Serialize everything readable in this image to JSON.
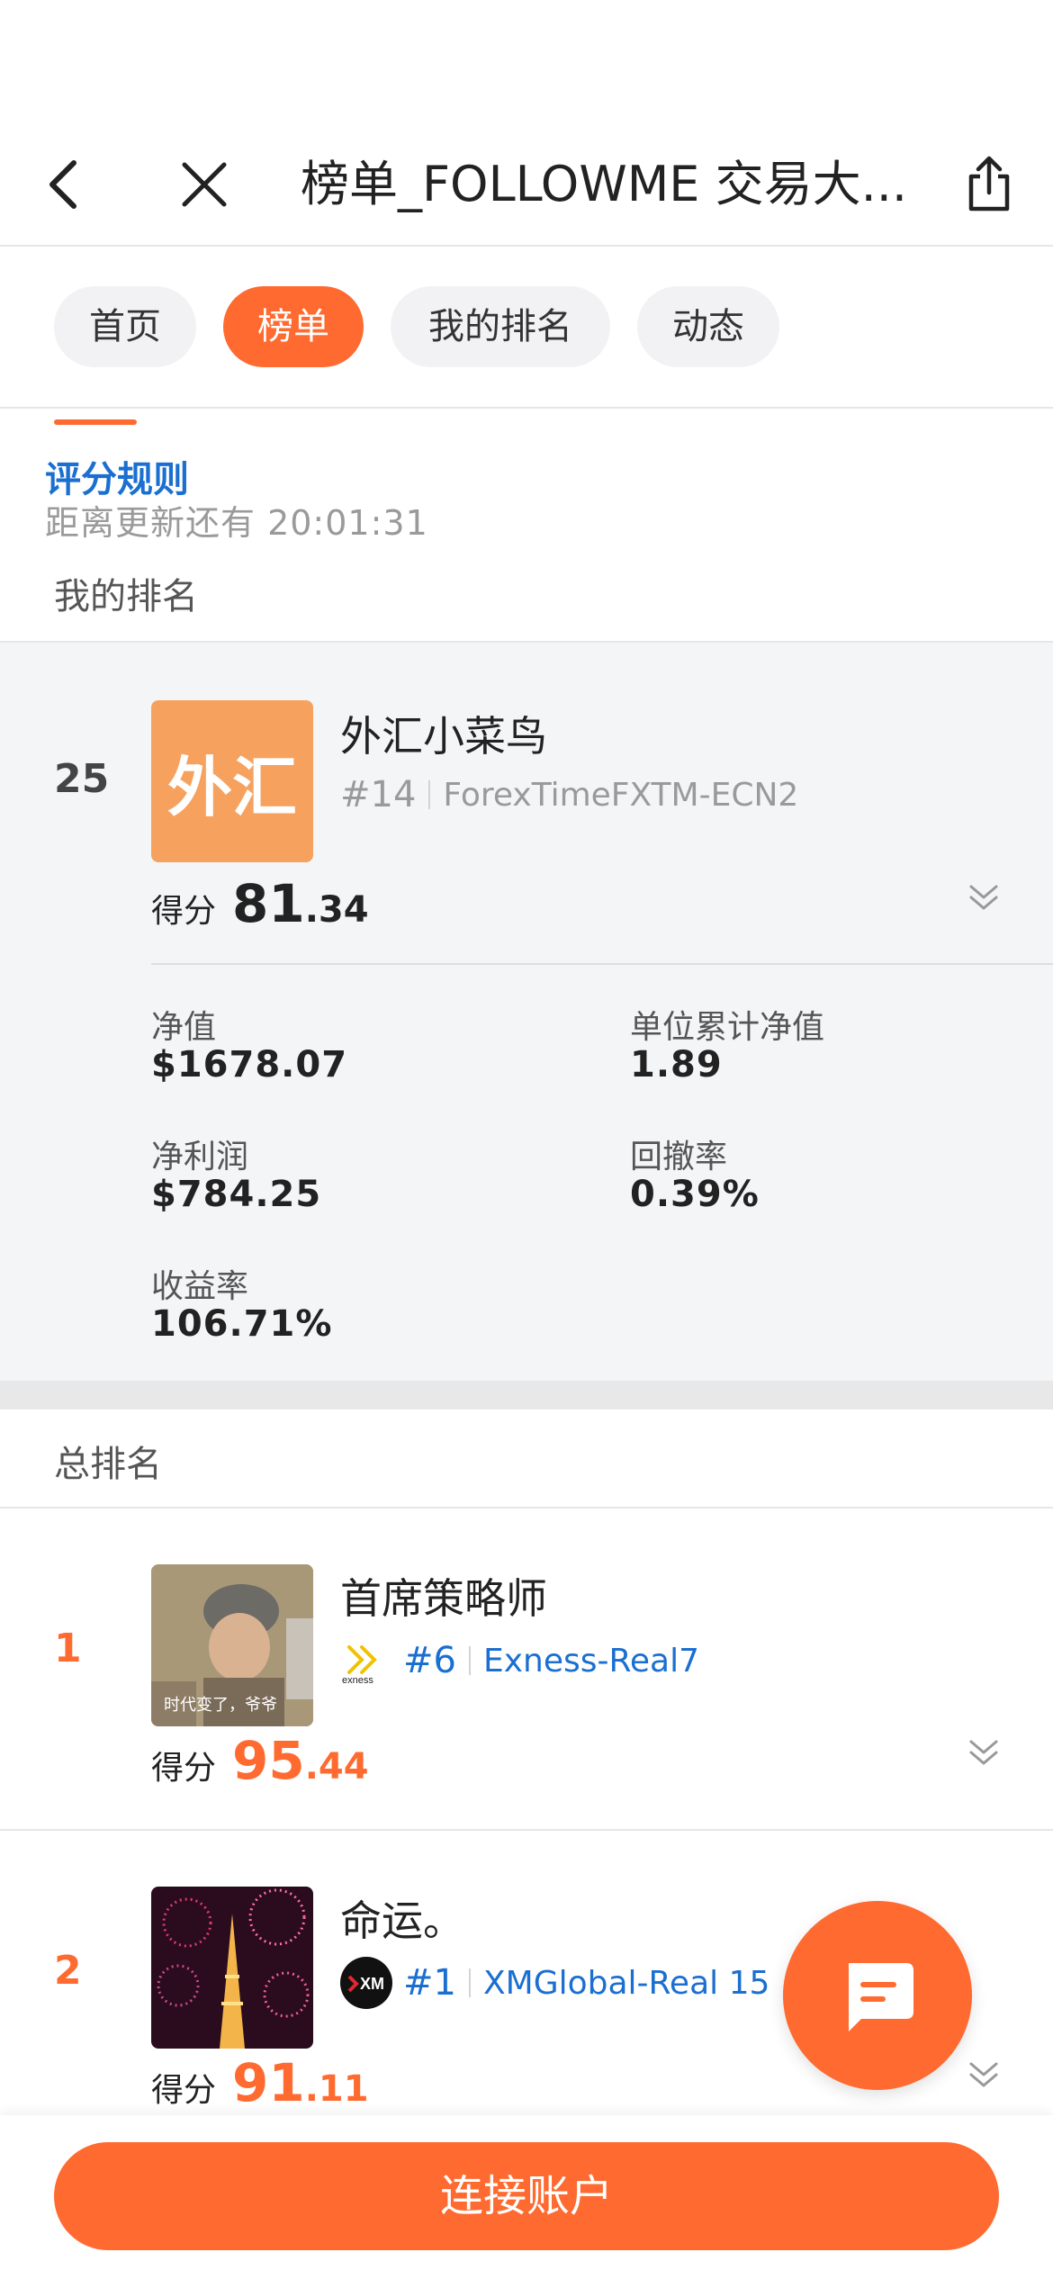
{
  "nav": {
    "title": "榜单_FOLLOWME 交易大...",
    "back_icon": "chevron-left-icon",
    "close_icon": "close-icon",
    "share_icon": "share-icon"
  },
  "tabs": [
    {
      "label": "首页",
      "active": false
    },
    {
      "label": "榜单",
      "active": true
    },
    {
      "label": "我的排名",
      "active": false
    },
    {
      "label": "动态",
      "active": false
    }
  ],
  "score_rules_link": "评分规则",
  "countdown": "距离更新还有 20:01:31",
  "my_rank": {
    "heading": "我的排名",
    "rank": "25",
    "avatar_text": "外汇",
    "name": "外汇小菜鸟",
    "account_rank": "#14",
    "broker": "ForexTimeFXTM-ECN2",
    "score_label": "得分",
    "score_int": "81",
    "score_dec": ".34",
    "stats": [
      {
        "label": "净值",
        "value": "$1678.07"
      },
      {
        "label": "单位累计净值",
        "value": "1.89"
      },
      {
        "label": "净利润",
        "value": "$784.25"
      },
      {
        "label": "回撤率",
        "value": "0.39%"
      },
      {
        "label": "收益率",
        "value": "106.71%"
      }
    ]
  },
  "total": {
    "heading": "总排名",
    "rows": [
      {
        "rank": "1",
        "name": "首席策略师",
        "account_rank": "#6",
        "broker": "Exness-Real7",
        "broker_logo_text": "exness",
        "photo_caption": "时代变了，爷爷",
        "score_label": "得分",
        "score_int": "95",
        "score_dec": ".44"
      },
      {
        "rank": "2",
        "name": "命运。",
        "account_rank": "#1",
        "broker": "XMGlobal-Real 15",
        "broker_logo_text": "XM",
        "score_label": "得分",
        "score_int": "91",
        "score_dec": ".11"
      }
    ]
  },
  "fab_icon": "chat-bubble-icon",
  "connect_button": "连接账户",
  "colors": {
    "accent": "#ff6a30",
    "link": "#1a6fd1",
    "avatar_bg": "#f7a15f"
  }
}
